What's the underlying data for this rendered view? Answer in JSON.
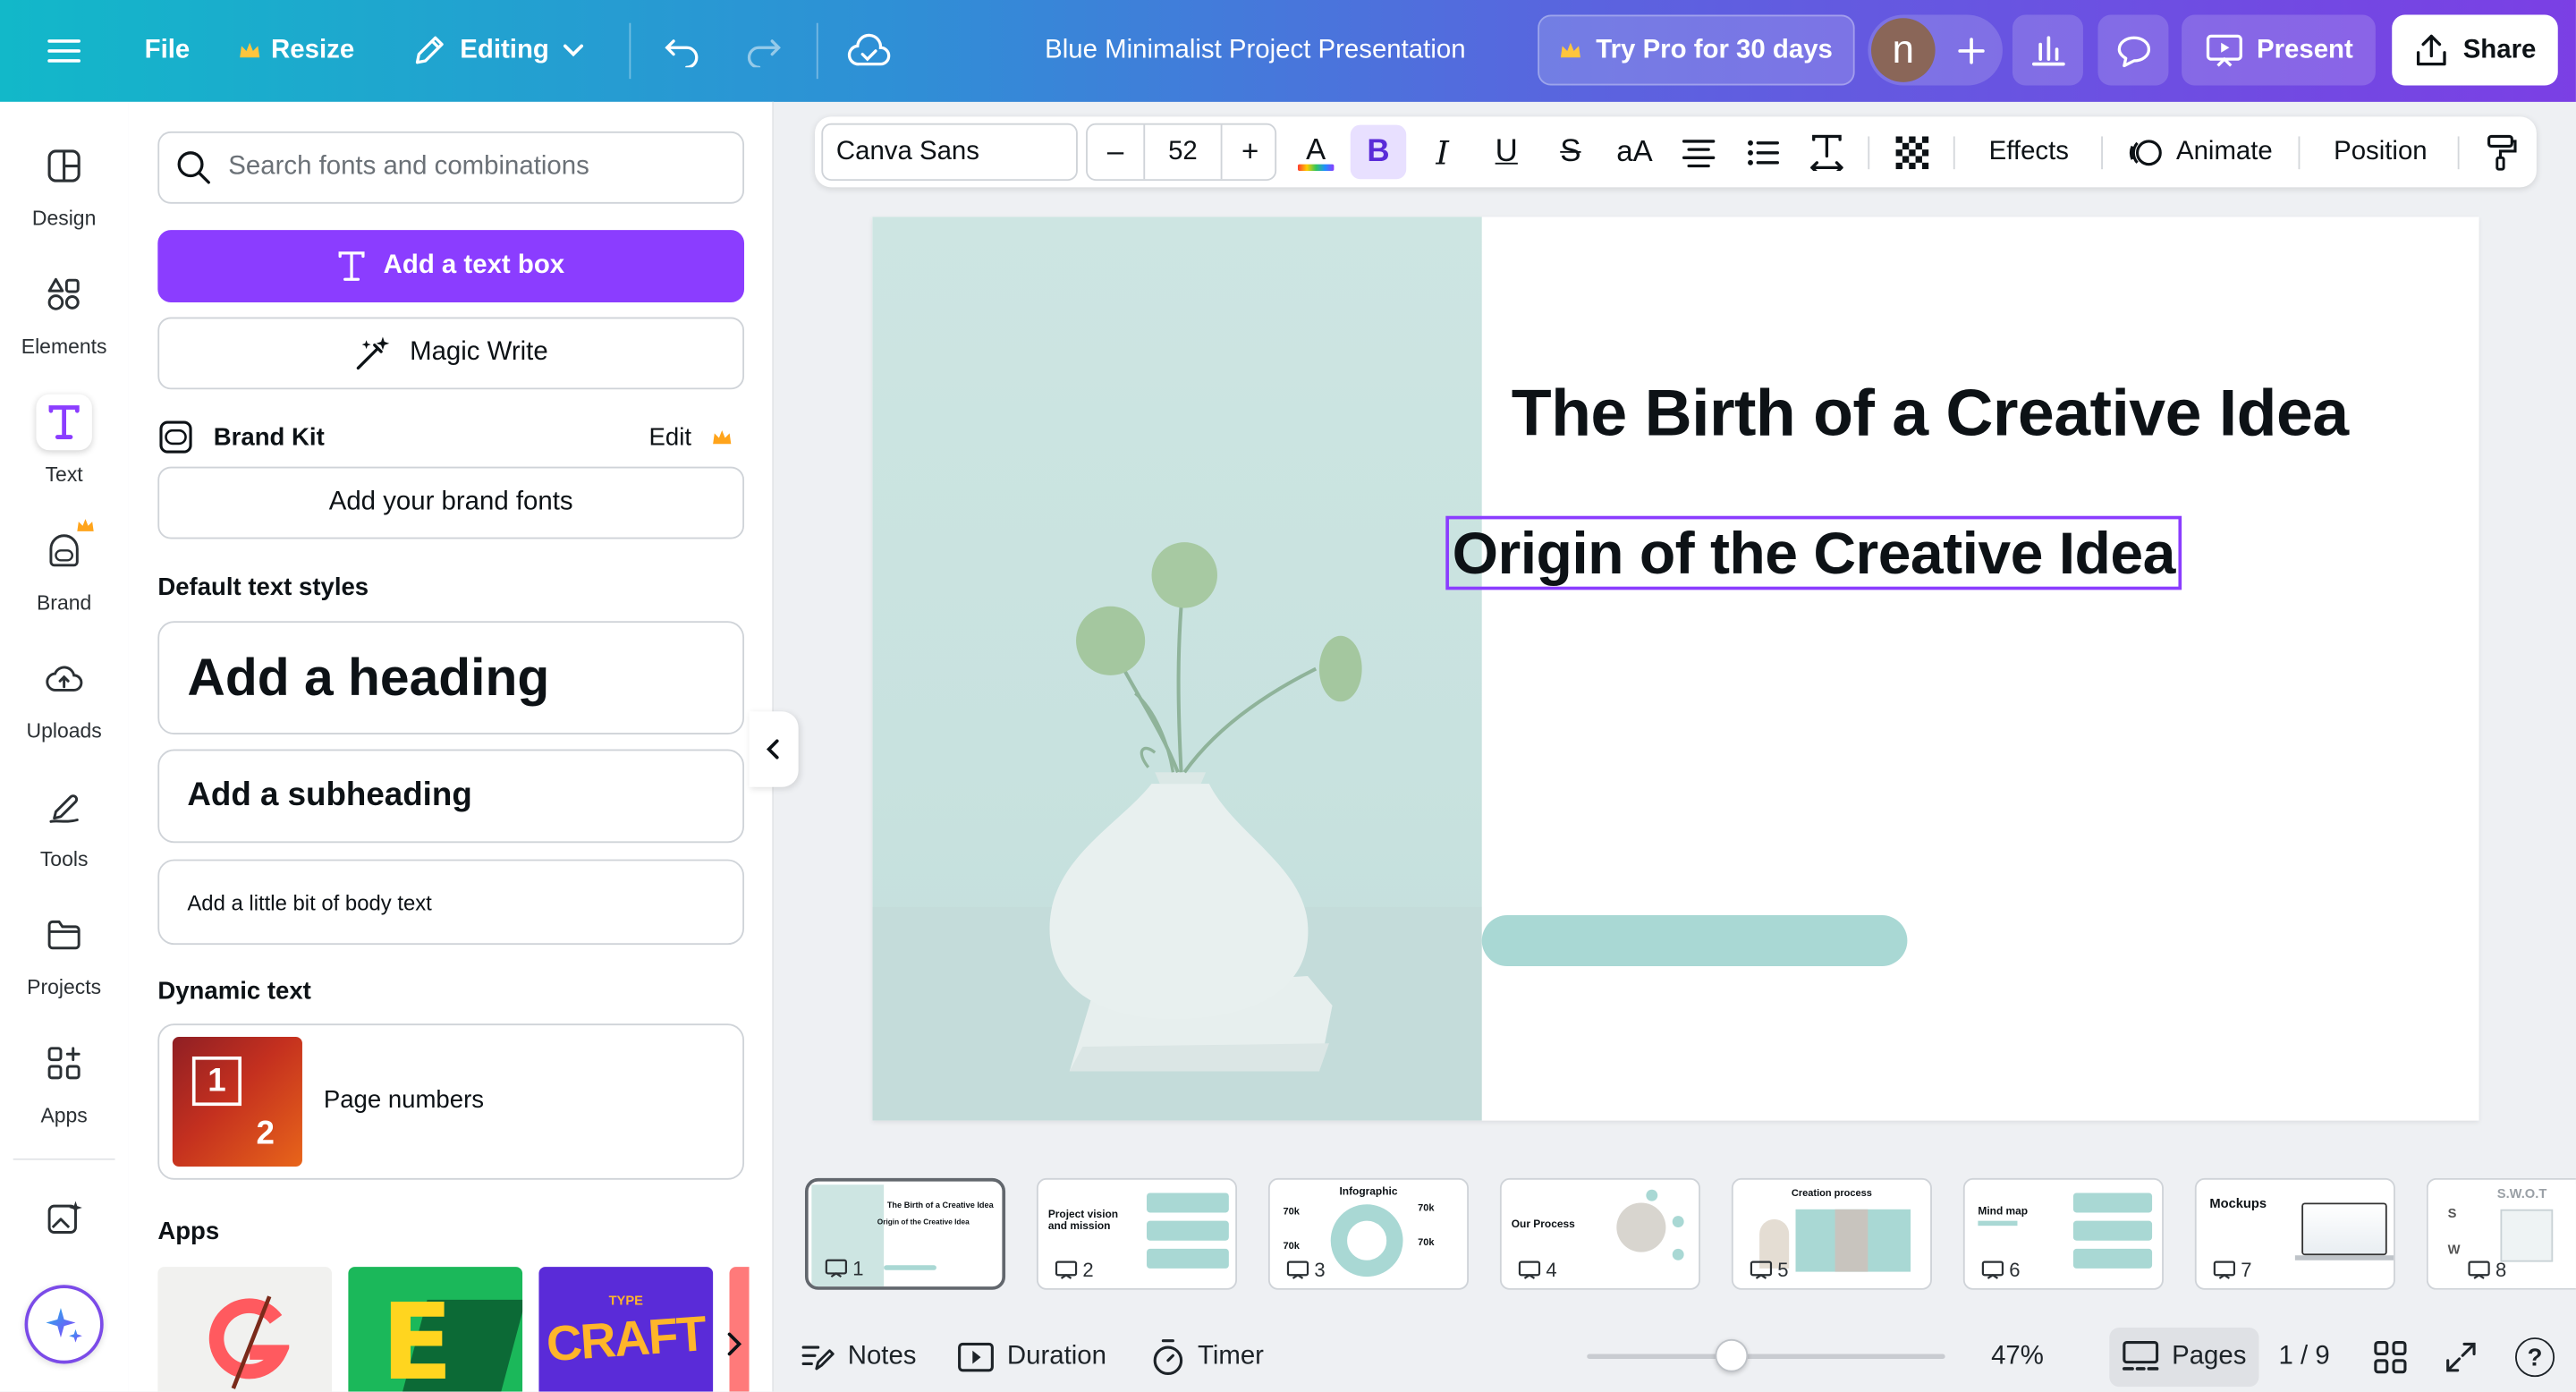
{
  "topbar": {
    "file": "File",
    "resize": "Resize",
    "editing": "Editing",
    "doc_title": "Blue Minimalist Project Presentation",
    "try_pro": "Try Pro for 30 days",
    "avatar_initial": "n",
    "present": "Present",
    "share": "Share"
  },
  "rail": {
    "items": [
      {
        "label": "Design"
      },
      {
        "label": "Elements"
      },
      {
        "label": "Text"
      },
      {
        "label": "Brand"
      },
      {
        "label": "Uploads"
      },
      {
        "label": "Tools"
      },
      {
        "label": "Projects"
      },
      {
        "label": "Apps"
      }
    ]
  },
  "panel": {
    "search_placeholder": "Search fonts and combinations",
    "add_text_box": "Add a text box",
    "magic_write": "Magic Write",
    "brand_kit": "Brand Kit",
    "brand_edit": "Edit",
    "add_brand_fonts": "Add your brand fonts",
    "default_styles": "Default text styles",
    "heading": "Add a heading",
    "subheading": "Add a subheading",
    "body": "Add a little bit of body text",
    "dynamic_text": "Dynamic text",
    "page_numbers": "Page numbers",
    "page_numbers_icon_1": "1",
    "page_numbers_icon_2": "2",
    "apps": "Apps",
    "app_tile_2": "E",
    "app_tile_3_small": "TYPE",
    "app_tile_3": "CRAFT"
  },
  "toolbar": {
    "font": "Canva Sans",
    "minus": "–",
    "size": "52",
    "plus": "+",
    "bold": "B",
    "italic": "I",
    "underline": "U",
    "strike": "S",
    "case": "aA",
    "effects": "Effects",
    "animate": "Animate",
    "position": "Position"
  },
  "slide": {
    "title": "The Birth of a Creative Idea",
    "subtitle": "Origin of the Creative Idea"
  },
  "thumbs": [
    {
      "n": "1",
      "t": "The Birth of a Creative Idea",
      "s": "Origin of the Creative Idea"
    },
    {
      "n": "2",
      "t": "Project vision and mission"
    },
    {
      "n": "3",
      "t": "Infographic",
      "v1": "70k",
      "v2": "70k",
      "v3": "70k",
      "v4": "70k"
    },
    {
      "n": "4",
      "t": "Our Process"
    },
    {
      "n": "5",
      "t": "Creation process"
    },
    {
      "n": "6",
      "t": "Mind map"
    },
    {
      "n": "7",
      "t": "Mockups"
    },
    {
      "n": "8",
      "t": "S.W.O.T",
      "s": "S",
      "w": "W"
    }
  ],
  "bottombar": {
    "notes": "Notes",
    "duration": "Duration",
    "timer": "Timer",
    "zoom": "47%",
    "pages": "Pages",
    "page_count": "1 / 9",
    "help": "?"
  },
  "colors": {
    "accent_purple": "#8b3dff",
    "slide_mint": "#cfe6e3",
    "bar_teal": "#a9d8d4",
    "selection": "#8b3dff"
  }
}
